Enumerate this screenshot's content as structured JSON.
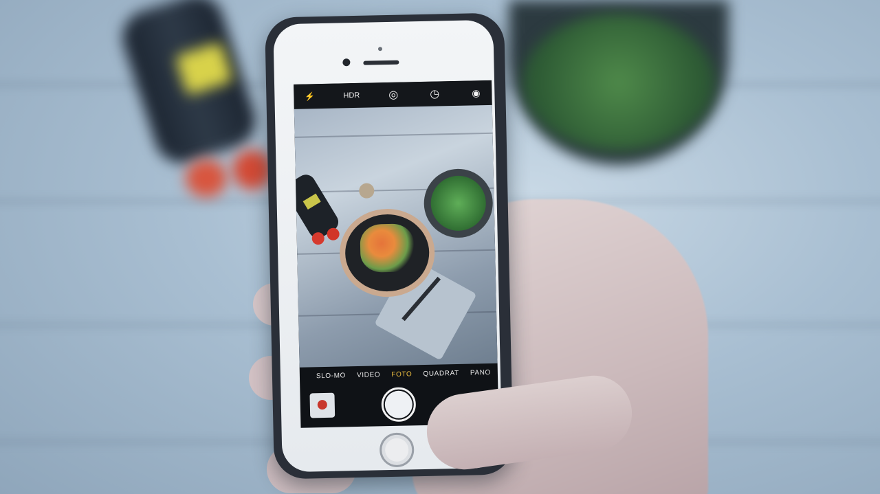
{
  "camera_app": {
    "top_bar": {
      "flash_icon": "⚡",
      "hdr_label": "HDR",
      "live_icon": "◎",
      "timer_icon": "◷",
      "filters_icon": "◉"
    },
    "modes": [
      {
        "label": "SLO-MO",
        "active": false
      },
      {
        "label": "VIDEO",
        "active": false
      },
      {
        "label": "FOTO",
        "active": true
      },
      {
        "label": "QUADRAT",
        "active": false
      },
      {
        "label": "PANO",
        "active": false
      }
    ],
    "flip_camera_icon": "⟲"
  },
  "colors": {
    "active_mode": "#f0c040",
    "screen_bg": "#0f1216"
  }
}
